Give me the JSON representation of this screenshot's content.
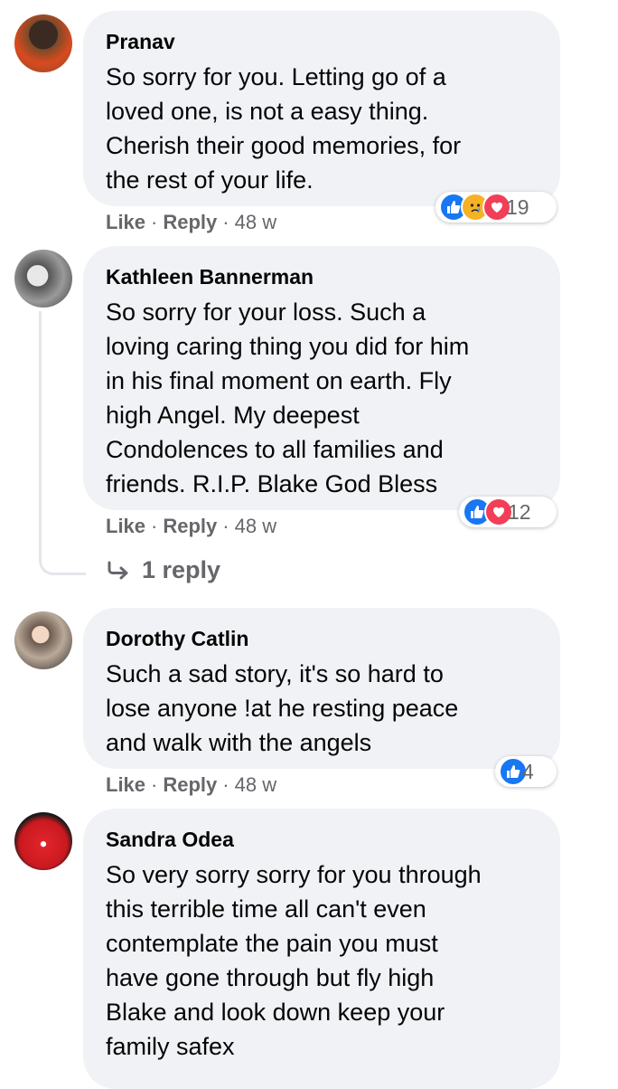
{
  "comments": [
    {
      "author": "Pranav",
      "text": "So sorry for you. Letting go of a\nloved one, is not a easy thing.\nCherish their good memories, for\nthe rest of your life.",
      "reaction_icons": [
        "like-icon",
        "sad-icon",
        "love-icon"
      ],
      "reaction_count": "19",
      "like_label": "Like",
      "reply_label": "Reply",
      "time": "48 w"
    },
    {
      "author": "Kathleen Bannerman",
      "text": "So sorry for your loss. Such a\nloving caring thing you did for him\nin his final moment on earth. Fly\nhigh Angel. My deepest\nCondolences to all families and\nfriends. R.I.P. Blake God Bless",
      "reaction_icons": [
        "like-icon",
        "love-icon"
      ],
      "reaction_count": "12",
      "like_label": "Like",
      "reply_label": "Reply",
      "time": "48 w",
      "replies_link": "1 reply"
    },
    {
      "author": "Dorothy Catlin",
      "text": "Such a sad story, it's so hard to\nlose anyone !at he resting peace\nand walk with the angels",
      "reaction_icons": [
        "like-icon"
      ],
      "reaction_count": "4",
      "like_label": "Like",
      "reply_label": "Reply",
      "time": "48 w"
    },
    {
      "author": "Sandra Odea",
      "text": "So very sorry sorry for you through\nthis terrible time all can't even\ncontemplate the pain you must\nhave gone through but fly high\nBlake and look down keep your\nfamily safex"
    }
  ],
  "colors": {
    "bubble": "#f0f2f5",
    "meta_text": "#65676b",
    "like": "#1877f2",
    "love": "#f33e58",
    "sad": "#f7b125"
  }
}
